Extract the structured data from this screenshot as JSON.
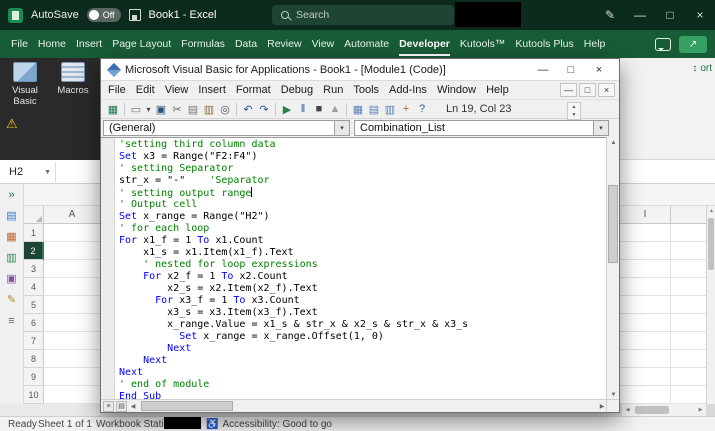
{
  "titlebar": {
    "autosave_label": "AutoSave",
    "autosave_state": "Off",
    "doc_title": "Book1 - Excel",
    "search_placeholder": "Search"
  },
  "ribbon": {
    "tabs": [
      {
        "label": "File"
      },
      {
        "label": "Home"
      },
      {
        "label": "Insert"
      },
      {
        "label": "Page Layout"
      },
      {
        "label": "Formulas"
      },
      {
        "label": "Data"
      },
      {
        "label": "Review"
      },
      {
        "label": "View"
      },
      {
        "label": "Automate"
      },
      {
        "label": "Developer",
        "active": true
      },
      {
        "label": "Kutools™"
      },
      {
        "label": "Kutools Plus"
      },
      {
        "label": "Help"
      }
    ],
    "visual_basic_label": "Visual Basic",
    "macros_label": "Macros",
    "right_fragment_label": "ort"
  },
  "formula_bar": {
    "name_box_value": "H2"
  },
  "kutools_sidebar": {
    "icons": [
      {
        "name": "expand-pane-icon",
        "glyph": "»",
        "color": "#217346"
      },
      {
        "name": "workbook-pane-icon",
        "glyph": "▤",
        "color": "#2e7dd1"
      },
      {
        "name": "grid-tools-icon",
        "glyph": "▦",
        "color": "#c0632f"
      },
      {
        "name": "column-list-icon",
        "glyph": "▥",
        "color": "#2e8b57"
      },
      {
        "name": "clipboard-pane-icon",
        "glyph": "▣",
        "color": "#7a52a8"
      },
      {
        "name": "edit-tools-icon",
        "glyph": "✎",
        "color": "#b08c2a"
      },
      {
        "name": "settings-icon",
        "glyph": "≡",
        "color": "#666666"
      }
    ]
  },
  "sheet": {
    "col_a_label": "A",
    "col_i_label": "I",
    "rows": [
      "1",
      "2",
      "3",
      "4",
      "5",
      "6",
      "7",
      "8",
      "9",
      "10"
    ],
    "selected_row": "2"
  },
  "vba": {
    "window_title": "Microsoft Visual Basic for Applications - Book1 - [Module1 (Code)]",
    "menu": [
      "File",
      "Edit",
      "View",
      "Insert",
      "Format",
      "Debug",
      "Run",
      "Tools",
      "Add-Ins",
      "Window",
      "Help"
    ],
    "toolbar": {
      "position_indicator": "Ln 19, Col 23",
      "icons": [
        {
          "name": "view-excel-icon",
          "glyph": "▦",
          "color": "#217346"
        },
        {
          "sep": true
        },
        {
          "name": "insert-userform-icon",
          "glyph": "▭",
          "color": "#6d6d6d"
        },
        {
          "name": "insert-dropdown-icon",
          "glyph": "▾",
          "color": "#444444",
          "narrow": true
        },
        {
          "name": "save-icon",
          "glyph": "▣",
          "color": "#29527a"
        },
        {
          "name": "cut-icon",
          "glyph": "✂",
          "color": "#666666"
        },
        {
          "name": "copy-icon",
          "glyph": "▤",
          "color": "#777777"
        },
        {
          "name": "paste-icon",
          "glyph": "▥",
          "color": "#8a6d3b"
        },
        {
          "name": "find-icon",
          "glyph": "◎",
          "color": "#555555"
        },
        {
          "sep": true
        },
        {
          "name": "undo-icon",
          "glyph": "↶",
          "color": "#2b5797"
        },
        {
          "name": "redo-icon",
          "glyph": "↷",
          "color": "#2b5797"
        },
        {
          "sep": true
        },
        {
          "name": "run-icon",
          "glyph": "▶",
          "color": "#2f7d4f"
        },
        {
          "name": "break-icon",
          "glyph": "‖",
          "color": "#2b5797"
        },
        {
          "name": "reset-icon",
          "glyph": "■",
          "color": "#444444"
        },
        {
          "name": "design-mode-icon",
          "glyph": "▲",
          "color": "#9aa0a6"
        },
        {
          "sep": true
        },
        {
          "name": "project-explorer-icon",
          "glyph": "▦",
          "color": "#5b7fb4"
        },
        {
          "name": "properties-window-icon",
          "glyph": "▤",
          "color": "#5b7fb4"
        },
        {
          "name": "object-browser-icon",
          "glyph": "▥",
          "color": "#5b7fb4"
        },
        {
          "name": "toolbox-icon",
          "glyph": "+",
          "color": "#b05c2a"
        },
        {
          "name": "help-icon",
          "glyph": "?",
          "color": "#2b5797"
        }
      ]
    },
    "combo_left": "(General)",
    "combo_right": "Combination_List",
    "code": {
      "lines": [
        {
          "tokens": [
            [
              "cm",
              "'setting third column data"
            ]
          ]
        },
        {
          "tokens": [
            [
              "kw",
              "Set"
            ],
            [
              "tx",
              " x3 = Range(\"F2:F4\")"
            ]
          ]
        },
        {
          "tokens": [
            [
              "cm",
              "' setting Separator"
            ]
          ]
        },
        {
          "tokens": [
            [
              "tx",
              "str_x = \"-\"    "
            ],
            [
              "cm",
              "'Separator"
            ]
          ]
        },
        {
          "tokens": [
            [
              "cm",
              "' setting output range"
            ]
          ],
          "caret": true
        },
        {
          "tokens": [
            [
              "cm",
              "' Output cell"
            ]
          ]
        },
        {
          "tokens": [
            [
              "kw",
              "Set"
            ],
            [
              "tx",
              " x_range = Range(\"H2\")"
            ]
          ]
        },
        {
          "tokens": [
            [
              "cm",
              "' for each loop"
            ]
          ]
        },
        {
          "tokens": [
            [
              "kw",
              "For"
            ],
            [
              "tx",
              " x1_f = 1 "
            ],
            [
              "kw",
              "To"
            ],
            [
              "tx",
              " x1.Count"
            ]
          ]
        },
        {
          "tokens": [
            [
              "tx",
              "    x1_s = x1.Item(x1_f).Text"
            ]
          ]
        },
        {
          "tokens": [
            [
              "cm",
              "    ' nested for loop expressions"
            ]
          ]
        },
        {
          "tokens": [
            [
              "tx",
              "    "
            ],
            [
              "kw",
              "For"
            ],
            [
              "tx",
              " x2_f = 1 "
            ],
            [
              "kw",
              "To"
            ],
            [
              "tx",
              " x2.Count"
            ]
          ]
        },
        {
          "tokens": [
            [
              "tx",
              "        x2_s = x2.Item(x2_f).Text"
            ]
          ]
        },
        {
          "tokens": [
            [
              "tx",
              "      "
            ],
            [
              "kw",
              "For"
            ],
            [
              "tx",
              " x3_f = 1 "
            ],
            [
              "kw",
              "To"
            ],
            [
              "tx",
              " x3.Count"
            ]
          ]
        },
        {
          "tokens": [
            [
              "tx",
              "        x3_s = x3.Item(x3_f).Text"
            ]
          ]
        },
        {
          "tokens": [
            [
              "tx",
              "        x_range.Value = x1_s & str_x & x2_s & str_x & x3_s"
            ]
          ]
        },
        {
          "tokens": [
            [
              "tx",
              "          "
            ],
            [
              "kw",
              "Set"
            ],
            [
              "tx",
              " x_range = x_range.Offset(1, 0)"
            ]
          ]
        },
        {
          "tokens": [
            [
              "tx",
              "        "
            ],
            [
              "kw",
              "Next"
            ]
          ]
        },
        {
          "tokens": [
            [
              "tx",
              "    "
            ],
            [
              "kw",
              "Next"
            ]
          ]
        },
        {
          "tokens": [
            [
              "kw",
              "Next"
            ]
          ]
        },
        {
          "tokens": [
            [
              "cm",
              "' end of module"
            ]
          ]
        },
        {
          "tokens": [
            [
              "kw",
              "End Sub"
            ]
          ]
        }
      ]
    }
  },
  "statusbar": {
    "mode": "Ready",
    "sheet_info": "Sheet 1 of 1",
    "workbook_statistics": "Workbook Statistics",
    "accessibility": "Accessibility: Good to go"
  },
  "glyphs": {
    "minimize": "—",
    "maximize": "□",
    "restore": "□",
    "close": "×",
    "pen": "✎",
    "share": "↗",
    "dropdown": "▾",
    "namebox_dropdown": "▼",
    "select_all": "◢",
    "warning": "⚠",
    "up": "▲",
    "down": "▼",
    "left": "◀",
    "right": "▶",
    "updown": "↕",
    "accessibility": "♿",
    "proc_view": "≡",
    "module_view": "▤"
  },
  "colors": {
    "excel_green": "#185C37",
    "keyword_blue": "#0000FF",
    "comment_green": "#008000"
  }
}
